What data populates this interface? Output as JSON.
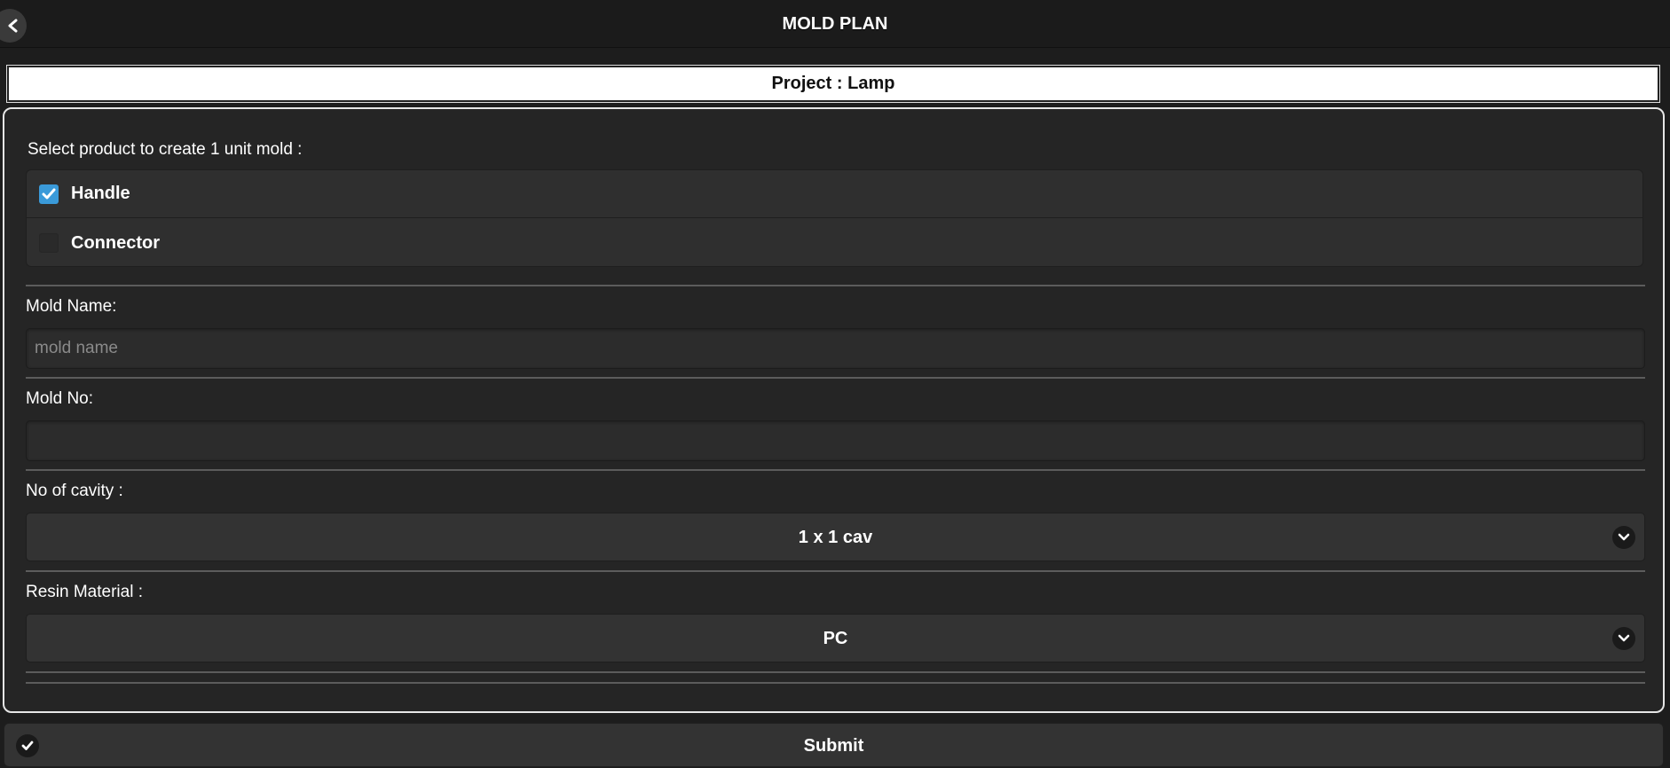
{
  "header": {
    "title": "MOLD PLAN",
    "back_icon": "chevron-left-icon"
  },
  "project": {
    "label": "Project : Lamp"
  },
  "products": {
    "label": "Select product to create 1 unit mold :",
    "items": [
      {
        "label": "Handle",
        "checked": true
      },
      {
        "label": "Connector",
        "checked": false
      }
    ]
  },
  "mold_name": {
    "label": "Mold Name:",
    "value": "",
    "placeholder": "mold name"
  },
  "mold_no": {
    "label": "Mold No:",
    "value": "",
    "placeholder": ""
  },
  "cavity": {
    "label": "No of cavity :",
    "selected": "1 x 1 cav"
  },
  "resin": {
    "label": "Resin Material :",
    "selected": "PC"
  },
  "submit": {
    "label": "Submit",
    "icon": "check-icon"
  },
  "colors": {
    "checkbox_checked": "#3a9ad9",
    "background": "#252525"
  }
}
